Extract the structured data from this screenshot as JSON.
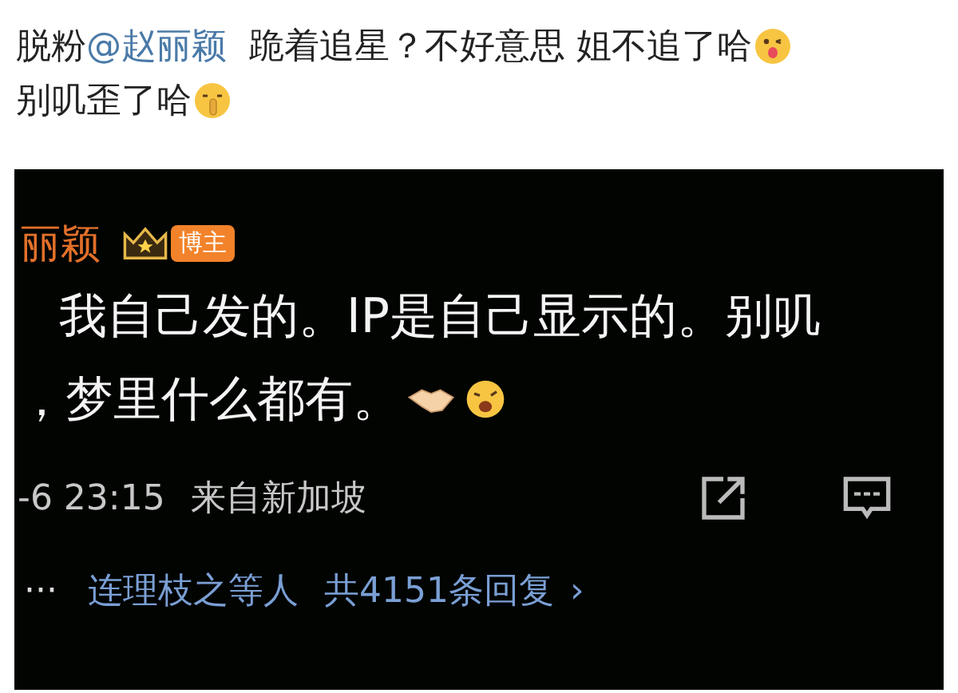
{
  "post": {
    "prefix": "脱粉",
    "mention": "@赵丽颖",
    "text": "跪着追星？不好意思 姐不追了哈",
    "text_2": "别叽歪了哈"
  },
  "screenshot": {
    "author": "丽颖",
    "badge": "博主",
    "lines": [
      "我自己发的。IP是自己显示的。别叽",
      "，梦里什么都有。"
    ],
    "time": "-6 23:15",
    "location": "来自新加坡",
    "more": "···",
    "reply_author": "连理枝之等人",
    "reply_count": "共4151条回复",
    "reply_arrow": "›"
  }
}
